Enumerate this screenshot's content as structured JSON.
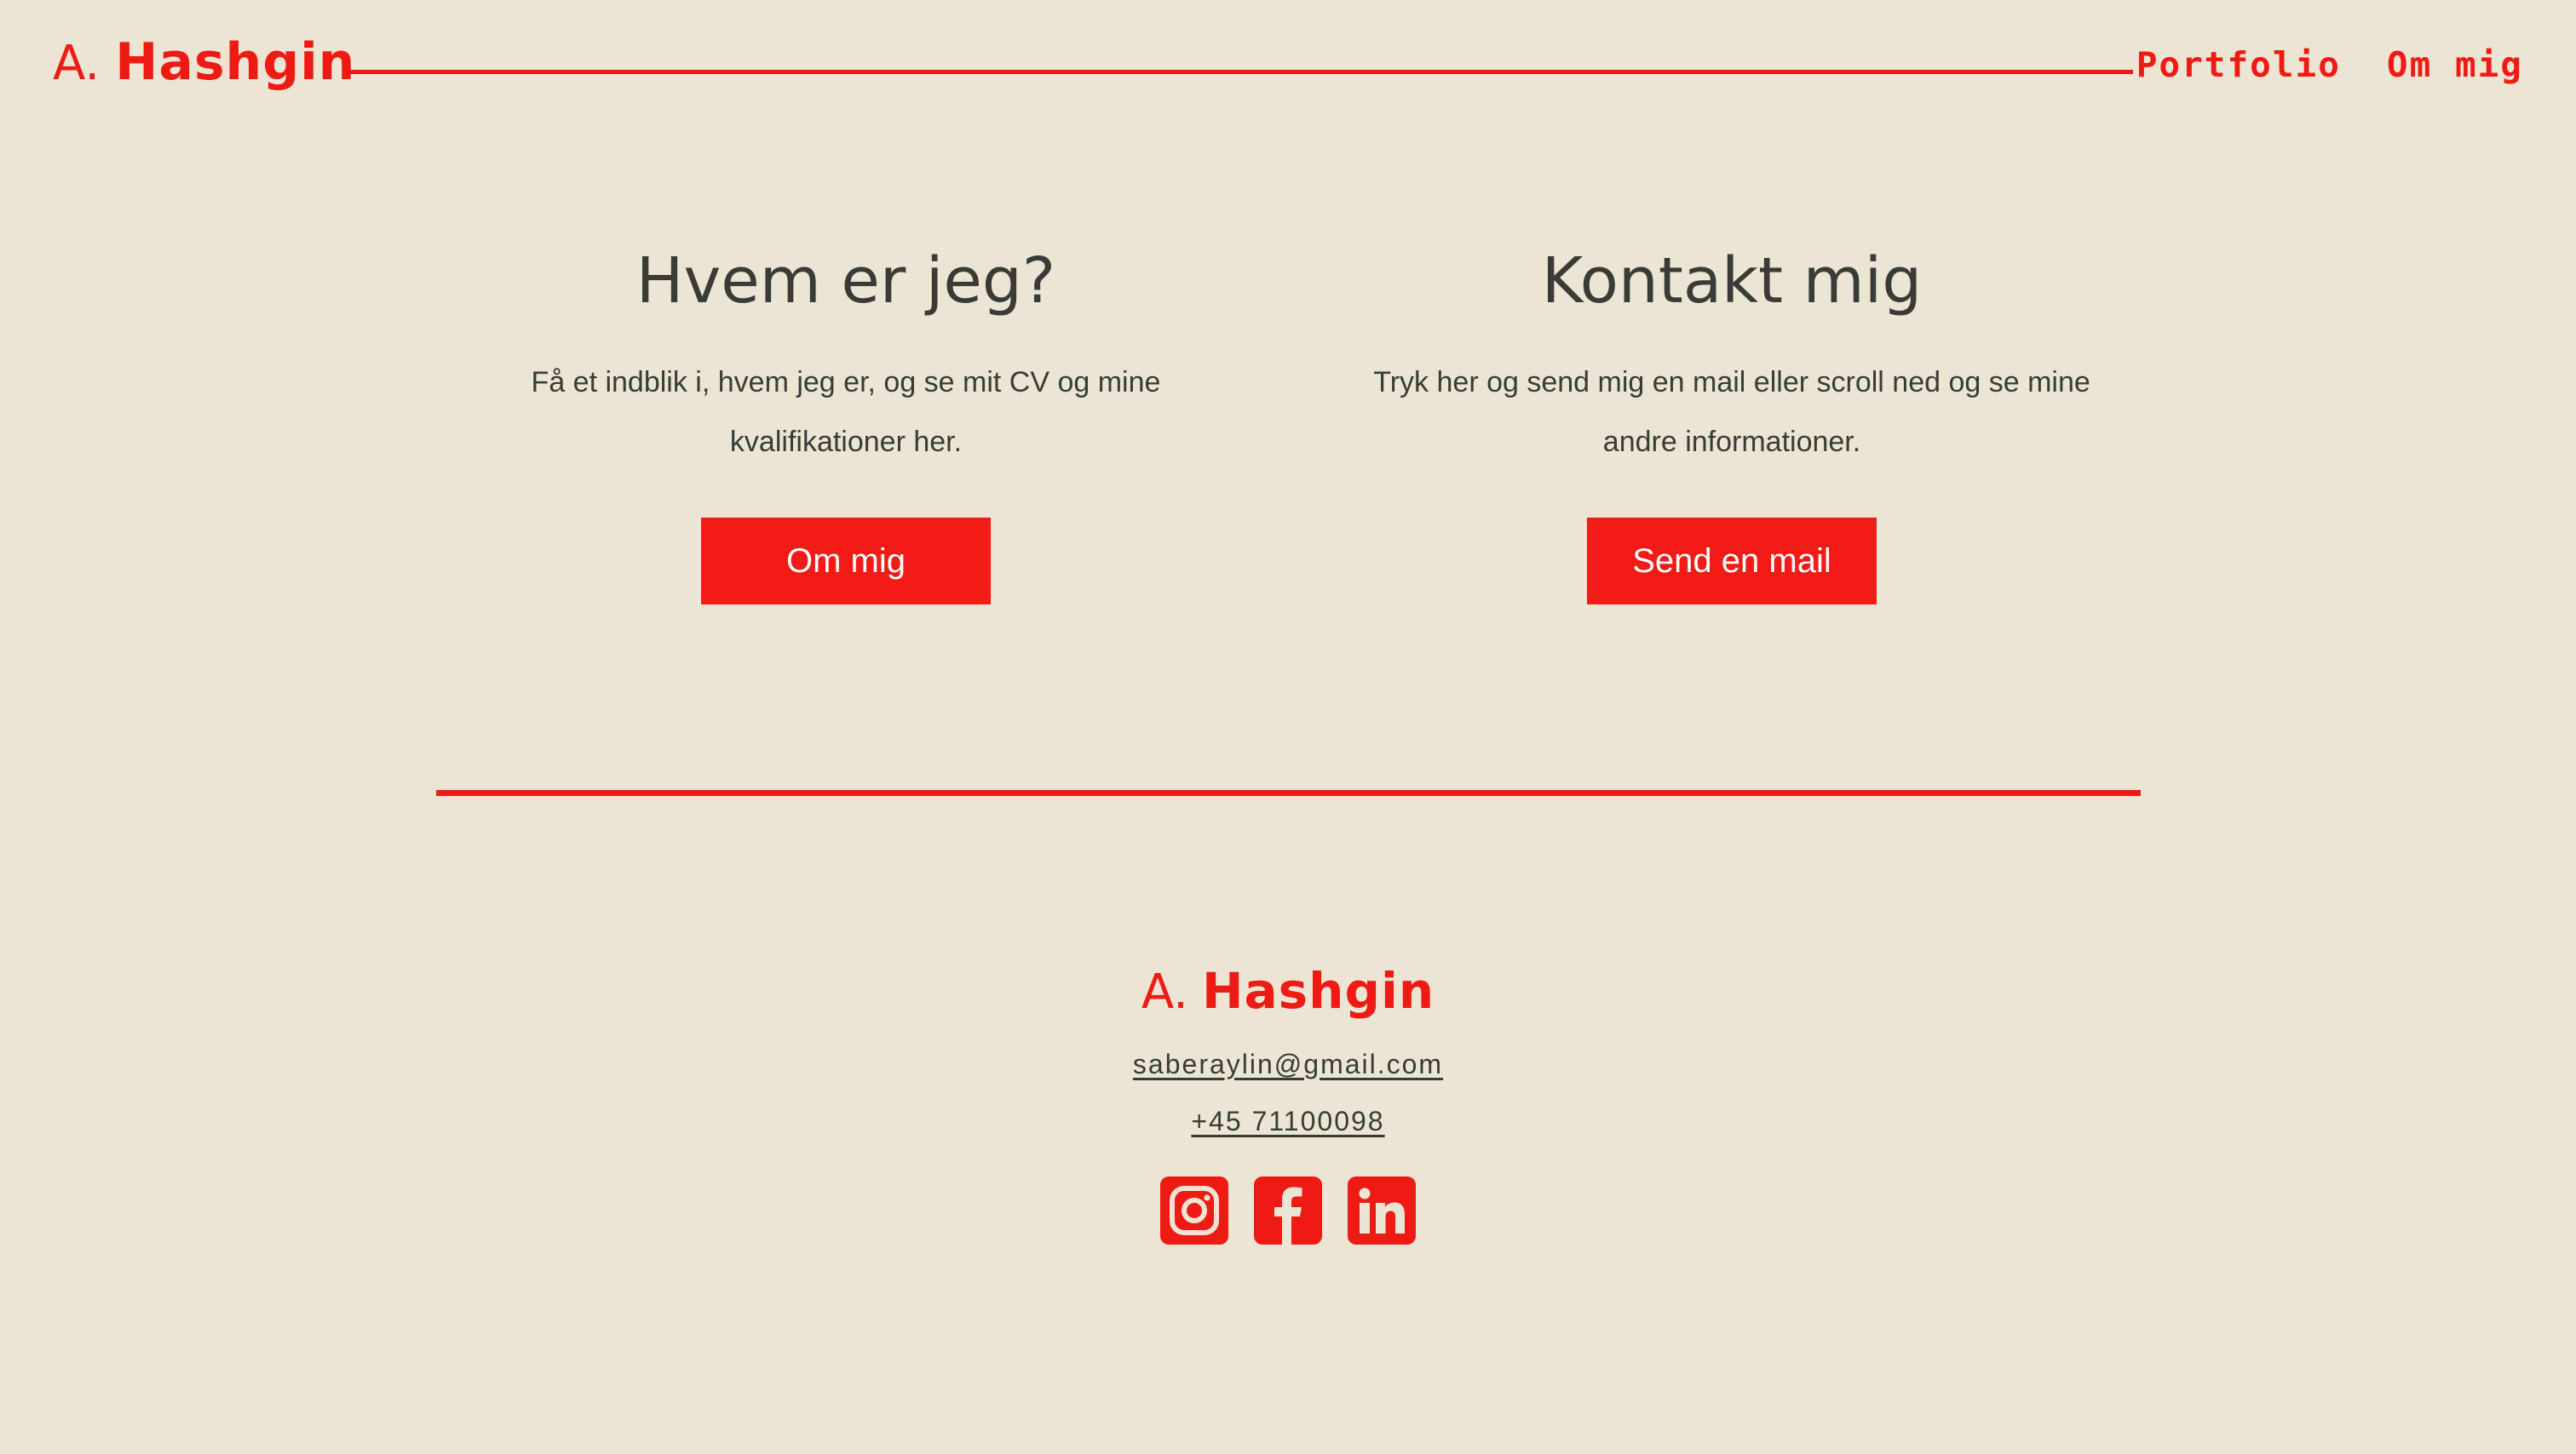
{
  "brand": {
    "initial": "A.",
    "name": "Hashgin",
    "accent_color": "#ee1b15",
    "background_color": "#ede5d3",
    "text_color": "#3c3a37"
  },
  "nav": {
    "items": [
      {
        "label": "Portfolio"
      },
      {
        "label": "Om mig"
      }
    ]
  },
  "about": {
    "heading": "Hvem er jeg?",
    "text": "Få et indblik i, hvem jeg er, og se mit CV og mine kvalifikationer her.",
    "button_label": "Om mig"
  },
  "contact": {
    "heading": "Kontakt mig",
    "text": "Tryk her og send mig en mail eller scroll ned og se mine andre informationer.",
    "button_label": "Send en mail"
  },
  "footer": {
    "logo_initial": "A.",
    "logo_name": "Hashgin",
    "email": "saberaylin@gmail.com",
    "phone": "+45 71100098",
    "socials": [
      {
        "icon": "instagram-icon"
      },
      {
        "icon": "facebook-icon"
      },
      {
        "icon": "linkedin-icon"
      }
    ]
  }
}
